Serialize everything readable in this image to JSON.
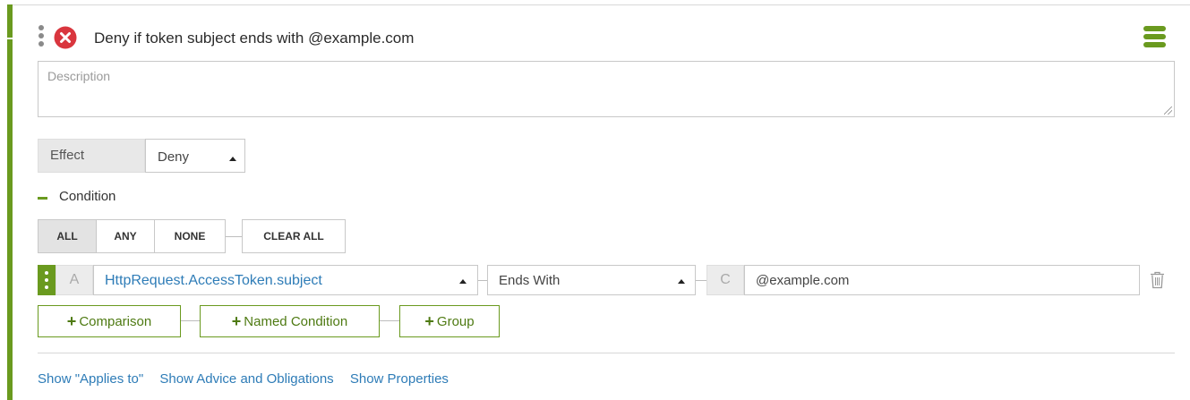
{
  "rule": {
    "title": "Deny if token subject ends with @example.com",
    "status_icon": "x-circle-icon",
    "status_color": "#d9363e",
    "menu_icon": "hamburger-icon"
  },
  "description": {
    "placeholder": "Description",
    "value": ""
  },
  "effect": {
    "label": "Effect",
    "selected": "Deny"
  },
  "condition": {
    "label": "Condition",
    "mode_buttons": [
      "ALL",
      "ANY",
      "NONE"
    ],
    "active_mode": "ALL",
    "clear_label": "CLEAR ALL",
    "comparison": {
      "left_badge": "A",
      "attribute": "HttpRequest.AccessToken.subject",
      "operator": "Ends With",
      "right_badge": "C",
      "value": "@example.com"
    },
    "add_buttons": [
      "Comparison",
      "Named Condition",
      "Group"
    ]
  },
  "links": [
    "Show \"Applies to\"",
    "Show Advice and Obligations",
    "Show Properties"
  ],
  "colors": {
    "accent": "#6a9a1f",
    "link": "#2e7cb7"
  }
}
